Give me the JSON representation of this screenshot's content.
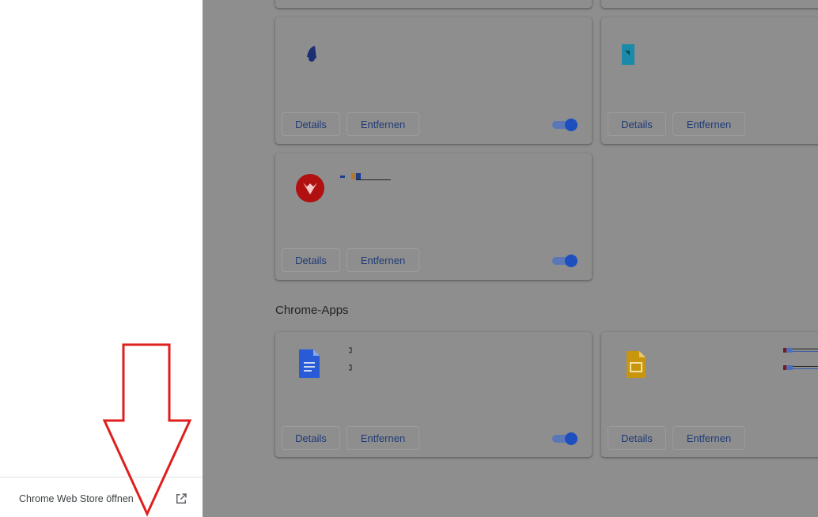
{
  "sidebar": {
    "webstore_label": "Chrome Web Store öffnen"
  },
  "buttons": {
    "details": "Details",
    "remove": "Entfernen"
  },
  "sections": {
    "apps_title": "Chrome-Apps"
  },
  "icons": {
    "external_link": "external-link-icon"
  },
  "colors": {
    "accent": "#1d4fbf",
    "arrow": "#e01e1e"
  }
}
